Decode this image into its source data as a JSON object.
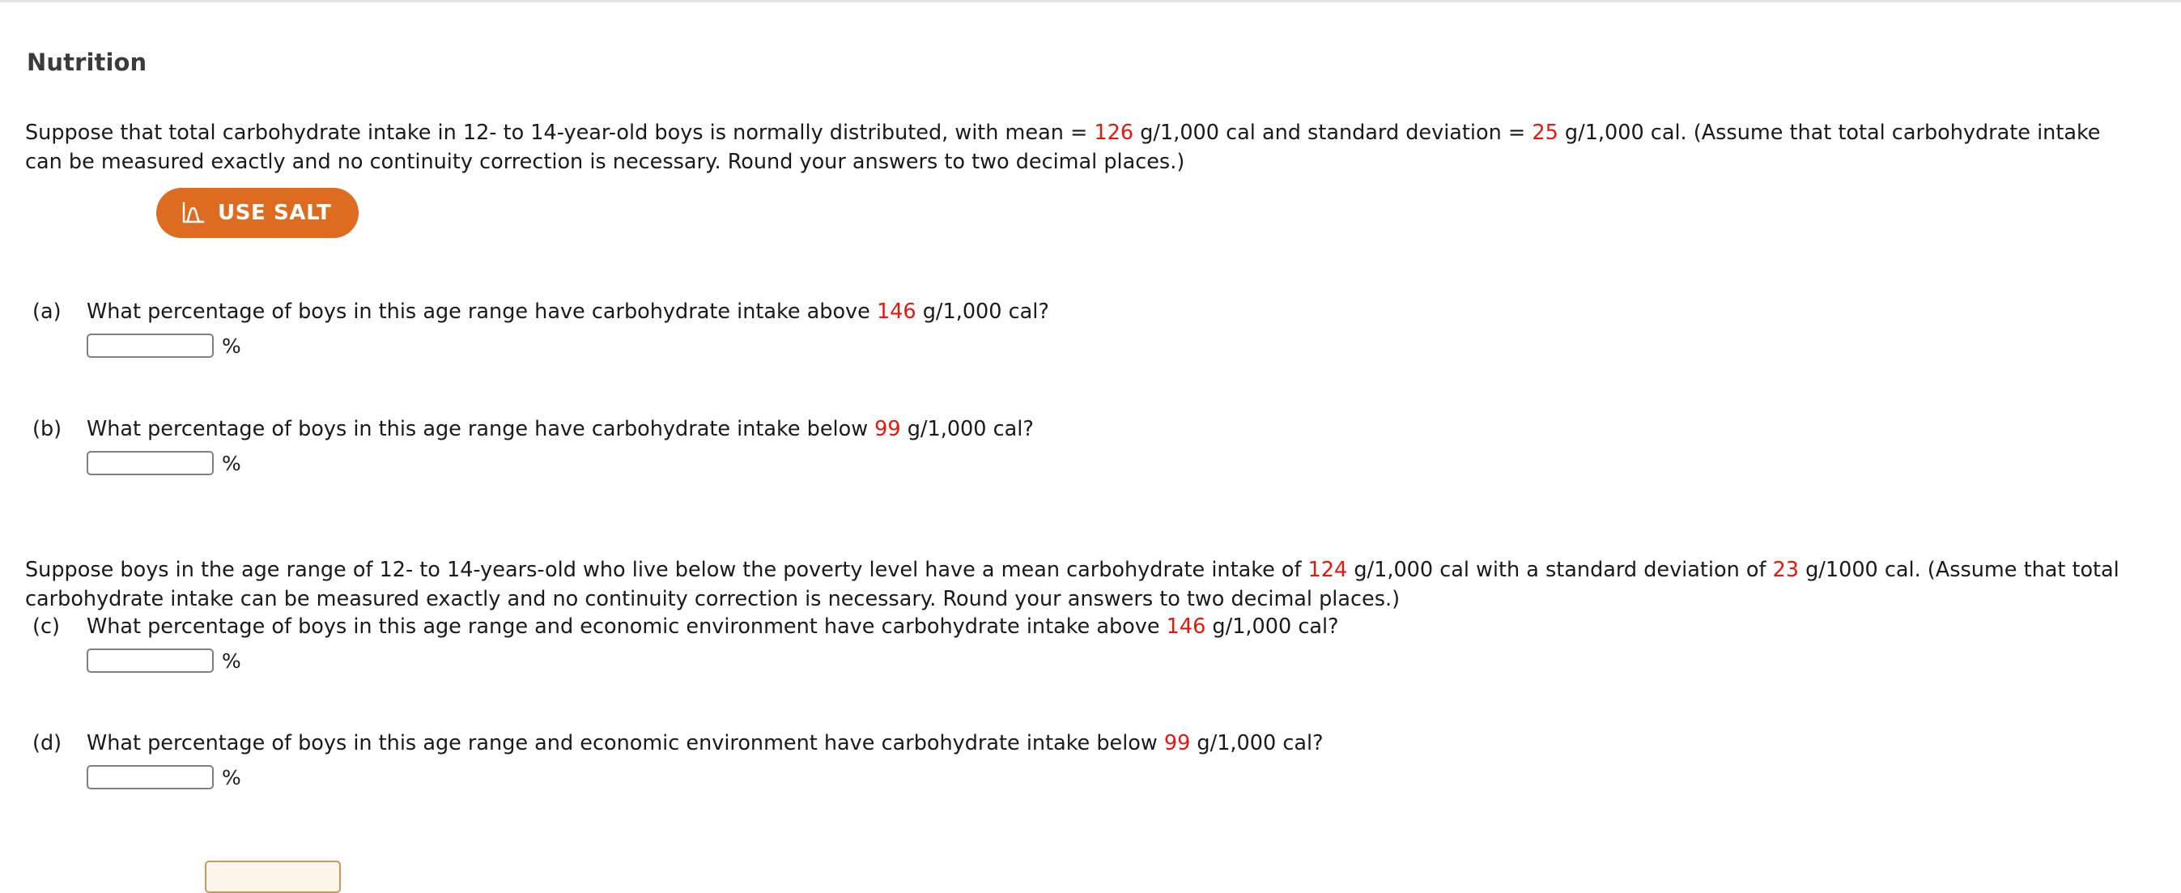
{
  "page": {
    "title": "Nutrition"
  },
  "intro_1": {
    "part_1": "Suppose that total carbohydrate intake in 12- to 14-year-old boys is normally distributed, with mean = ",
    "mean": "126",
    "part_2": " g/1,000 cal and standard deviation = ",
    "sd": "25",
    "part_3": " g/1,000 cal. (Assume that total carbohydrate intake can be measured exactly and no continuity correction is necessary. Round your answers to two decimal places.)"
  },
  "salt_button": {
    "label": "USE SALT",
    "icon": "normal-curve-icon",
    "color": "#dd6b20"
  },
  "questions": [
    {
      "label": "(a)",
      "text_before": "What percentage of boys in this age range have carbohydrate intake above ",
      "value": "146",
      "text_after": " g/1,000 cal?",
      "input_value": "",
      "unit": "%"
    },
    {
      "label": "(b)",
      "text_before": "What percentage of boys in this age range have carbohydrate intake below ",
      "value": "99",
      "text_after": " g/1,000 cal?",
      "input_value": "",
      "unit": "%"
    },
    {
      "label": "(c)",
      "text_before": "What percentage of boys in this age range and economic environment have carbohydrate intake above ",
      "value": "146",
      "text_after": " g/1,000 cal?",
      "input_value": "",
      "unit": "%"
    },
    {
      "label": "(d)",
      "text_before": "What percentage of boys in this age range and economic environment have carbohydrate intake below ",
      "value": "99",
      "text_after": " g/1,000 cal?",
      "input_value": "",
      "unit": "%"
    }
  ],
  "intro_2": {
    "part_1": "Suppose boys in the age range of 12- to 14-years-old who live below the poverty level have a mean carbohydrate intake of ",
    "mean": "124",
    "part_2": " g/1,000 cal with a standard deviation of ",
    "sd": "23",
    "part_3": " g/1000 cal. (Assume that total carbohydrate intake can be measured exactly and no continuity correction is necessary. Round your answers to two decimal places.)"
  },
  "colors": {
    "value_red": "#e8160c",
    "salt_orange": "#dd6b20",
    "title_gray": "#3b3b3b"
  }
}
